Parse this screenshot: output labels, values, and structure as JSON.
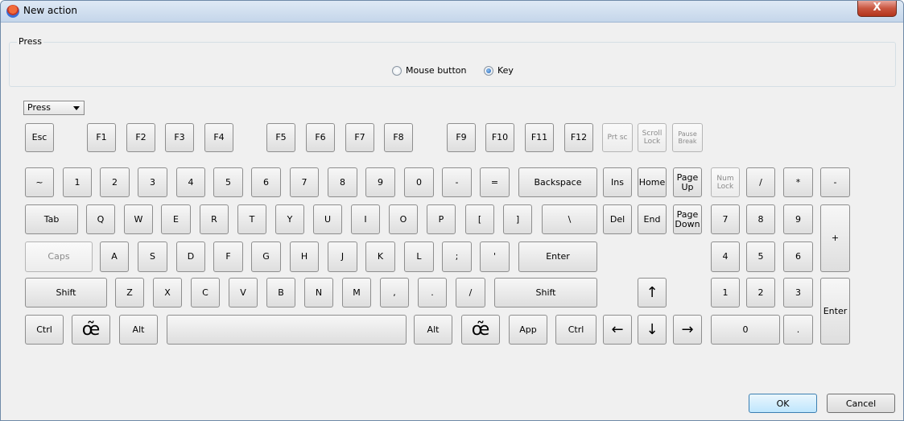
{
  "window": {
    "title": "New action",
    "close_label": "X"
  },
  "press_group": {
    "title": "Press",
    "options": [
      {
        "label": "Mouse button",
        "checked": false
      },
      {
        "label": "Key",
        "checked": true
      }
    ]
  },
  "action_type": {
    "value": "Press"
  },
  "keys": {
    "esc": "Esc",
    "f1": "F1",
    "f2": "F2",
    "f3": "F3",
    "f4": "F4",
    "f5": "F5",
    "f6": "F6",
    "f7": "F7",
    "f8": "F8",
    "f9": "F9",
    "f10": "F10",
    "f11": "F11",
    "f12": "F12",
    "prtsc": "Prt sc",
    "scroll_lock": "Scroll Lock",
    "pause_break": "Pause Break",
    "tilde": "~",
    "d1": "1",
    "d2": "2",
    "d3": "3",
    "d4": "4",
    "d5": "5",
    "d6": "6",
    "d7": "7",
    "d8": "8",
    "d9": "9",
    "d0": "0",
    "minus": "-",
    "equals": "=",
    "backspace": "Backspace",
    "ins": "Ins",
    "home": "Home",
    "page_up": "Page Up",
    "num_lock": "Num Lock",
    "np_slash": "/",
    "np_star": "*",
    "np_minus": "-",
    "tab": "Tab",
    "q": "Q",
    "w": "W",
    "e": "E",
    "r": "R",
    "t": "T",
    "y": "Y",
    "u": "U",
    "i": "I",
    "o": "O",
    "p": "P",
    "lbracket": "[",
    "rbracket": "]",
    "backslash": "\\",
    "del": "Del",
    "end": "End",
    "page_down": "Page Down",
    "np7": "7",
    "np8": "8",
    "np9": "9",
    "np_plus": "+",
    "caps": "Caps",
    "a": "A",
    "s": "S",
    "d": "D",
    "f": "F",
    "g": "G",
    "h": "H",
    "j": "J",
    "k": "K",
    "l": "L",
    "semicolon": ";",
    "quote": "'",
    "enter": "Enter",
    "np4": "4",
    "np5": "5",
    "np6": "6",
    "shift_l": "Shift",
    "z": "Z",
    "x": "X",
    "c": "C",
    "v": "V",
    "b": "B",
    "n": "N",
    "m": "M",
    "comma": ",",
    "period": ".",
    "slash": "/",
    "shift_r": "Shift",
    "up": "↑",
    "np1": "1",
    "np2": "2",
    "np3": "3",
    "np_enter": "Enter",
    "ctrl_l": "Ctrl",
    "win_l": "œ̃",
    "alt_l": "Alt",
    "space": "",
    "alt_r": "Alt",
    "win_r": "œ̃",
    "app": "App",
    "ctrl_r": "Ctrl",
    "left": "←",
    "down": "↓",
    "right": "→",
    "np0": "0",
    "np_dot": "."
  },
  "footer": {
    "ok_label": "OK",
    "cancel_label": "Cancel"
  }
}
